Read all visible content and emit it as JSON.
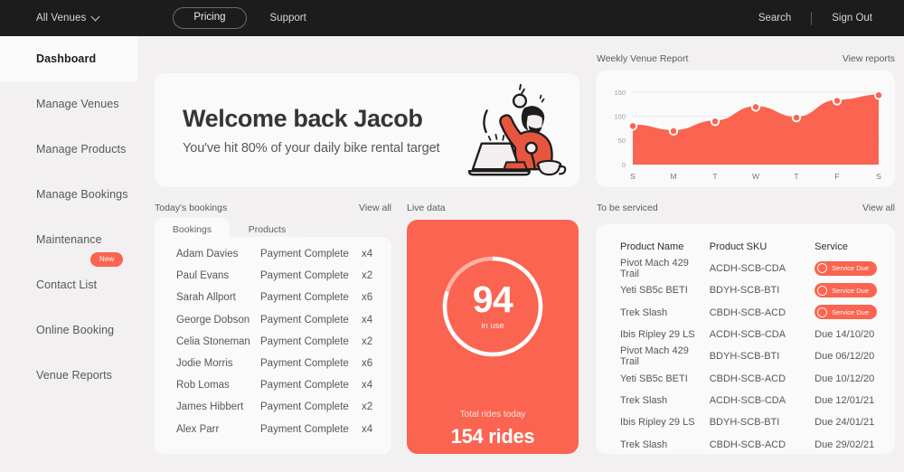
{
  "topnav": {
    "venues_label": "All Venues",
    "venues_icon": "chevron-down-icon",
    "pricing_label": "Pricing",
    "support_label": "Support",
    "search_label": "Search",
    "signout_label": "Sign Out"
  },
  "sidebar": {
    "items": [
      {
        "label": "Dashboard",
        "active": true
      },
      {
        "label": "Manage Venues",
        "active": false
      },
      {
        "label": "Manage Products",
        "active": false
      },
      {
        "label": "Manage Bookings",
        "active": false
      },
      {
        "label": "Maintenance",
        "active": false
      },
      {
        "label": "Contact List",
        "active": false,
        "badge": "New"
      },
      {
        "label": "Online Booking",
        "active": false
      },
      {
        "label": "Venue Reports",
        "active": false
      }
    ],
    "new_badge": "New"
  },
  "welcome": {
    "title": "Welcome back Jacob",
    "subtitle": "You've hit 80% of your daily bike rental target",
    "illustration": "person-celebrating-at-laptop-illustration"
  },
  "weekly": {
    "title": "Weekly Venue Report",
    "link": "View reports"
  },
  "bookings": {
    "title": "Today's bookings",
    "link": "View all",
    "tabs": [
      {
        "label": "Bookings",
        "selected": true
      },
      {
        "label": "Products",
        "selected": false
      }
    ],
    "rows": [
      {
        "name": "Adam Davies",
        "status": "Payment Complete",
        "qty": "x4"
      },
      {
        "name": "Paul Evans",
        "status": "Payment Complete",
        "qty": "x2"
      },
      {
        "name": "Sarah Allport",
        "status": "Payment Complete",
        "qty": "x6"
      },
      {
        "name": "George Dobson",
        "status": "Payment Complete",
        "qty": "x4"
      },
      {
        "name": "Celia Stoneman",
        "status": "Payment Complete",
        "qty": "x2"
      },
      {
        "name": "Jodie Morris",
        "status": "Payment Complete",
        "qty": "x6"
      },
      {
        "name": "Rob Lomas",
        "status": "Payment Complete",
        "qty": "x4"
      },
      {
        "name": "James Hibbert",
        "status": "Payment Complete",
        "qty": "x2"
      },
      {
        "name": "Alex Parr",
        "status": "Payment Complete",
        "qty": "x4"
      }
    ]
  },
  "live": {
    "title": "Live data",
    "in_use_value": "94",
    "in_use_label": "in use",
    "total_label": "Total rides today",
    "total_value": "154 rides",
    "ring_percent": 80
  },
  "serviced": {
    "title": "To be serviced",
    "link": "View all",
    "columns": [
      "Product Name",
      "Product SKU",
      "Service"
    ],
    "rows": [
      {
        "name": "Pivot Mach 429 Trail",
        "sku": "ACDH-SCB-CDA",
        "service": "Service Due",
        "due": true
      },
      {
        "name": "Yeti SB5c BETI",
        "sku": "BDYH-SCB-BTI",
        "service": "Service Due",
        "due": true
      },
      {
        "name": "Trek Slash",
        "sku": "CBDH-SCB-ACD",
        "service": "Service Due",
        "due": true
      },
      {
        "name": "Ibis Ripley 29 LS",
        "sku": "ACDH-SCB-CDA",
        "service": "Due 14/10/20",
        "due": false
      },
      {
        "name": "Pivot Mach 429 Trail",
        "sku": "BDYH-SCB-BTI",
        "service": "Due 06/12/20",
        "due": false
      },
      {
        "name": "Yeti SB5c BETI",
        "sku": "CBDH-SCB-ACD",
        "service": "Due 10/12/20",
        "due": false
      },
      {
        "name": "Trek Slash",
        "sku": "ACDH-SCB-CDA",
        "service": "Due 12/01/21",
        "due": false
      },
      {
        "name": "Ibis Ripley 29 LS",
        "sku": "BDYH-SCB-BTI",
        "service": "Due 24/01/21",
        "due": false
      },
      {
        "name": "Trek Slash",
        "sku": "CBDH-SCB-ACD",
        "service": "Due 29/02/21",
        "due": false
      }
    ]
  },
  "colors": {
    "accent": "#fa6450",
    "nav_bg": "#1c1c1c",
    "page_bg": "#f2f0f1",
    "card_bg": "#fafafa"
  },
  "chart_data": {
    "type": "area",
    "title": "Weekly Venue Report",
    "xlabel": "",
    "ylabel": "",
    "categories": [
      "S",
      "M",
      "T",
      "W",
      "T",
      "F",
      "S"
    ],
    "values": [
      80,
      70,
      90,
      120,
      97,
      133,
      145
    ],
    "ylim": [
      0,
      160
    ],
    "yticks": [
      0,
      50,
      100,
      150
    ],
    "grid": true,
    "legend": "none",
    "series_color": "#fa6450",
    "marker": "circle-white-filled-accent"
  }
}
